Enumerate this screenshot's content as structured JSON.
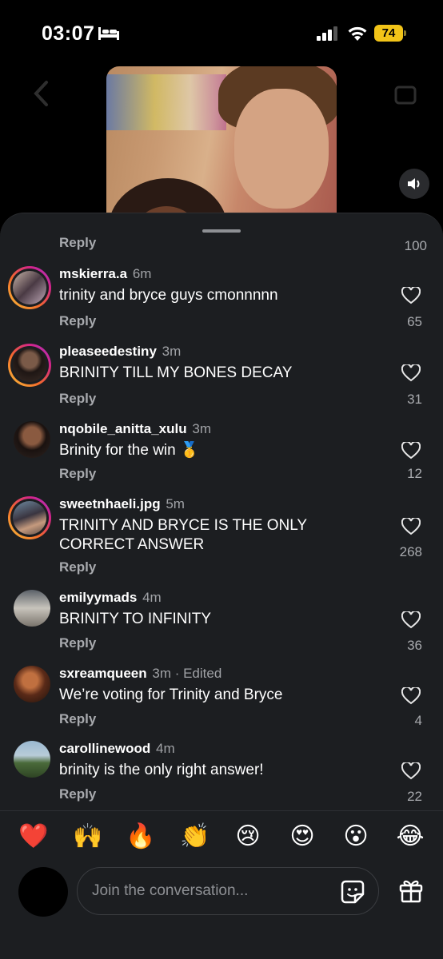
{
  "status_bar": {
    "time": "03:07",
    "battery": "74",
    "colors": {
      "battery": "#f2c418"
    }
  },
  "comments_header": {
    "partial_reply": "Reply",
    "partial_likes": "100"
  },
  "comments": [
    {
      "username": "mskierra.a",
      "time": "6m",
      "text": "trinity and bryce guys cmonnnnn",
      "reply": "Reply",
      "likes": "65"
    },
    {
      "username": "pleaseedestiny",
      "time": "3m",
      "text": "BRINITY TILL MY BONES DECAY",
      "reply": "Reply",
      "likes": "31"
    },
    {
      "username": "nqobile_anitta_xulu",
      "time": "3m",
      "text": "Brinity for the win 🥇",
      "reply": "Reply",
      "likes": "12"
    },
    {
      "username": "sweetnhaeli.jpg",
      "time": "5m",
      "text": "TRINITY AND BRYCE IS THE ONLY CORRECT ANSWER",
      "reply": "Reply",
      "likes": "268"
    },
    {
      "username": "emilyymads",
      "time": "4m",
      "text": "BRINITY TO INFINITY",
      "reply": "Reply",
      "likes": "36"
    },
    {
      "username": "sxreamqueen",
      "time": "3m · Edited",
      "text": "We’re voting for Trinity and Bryce",
      "reply": "Reply",
      "likes": "4"
    },
    {
      "username": "carollinewood",
      "time": "4m",
      "text": "brinity is the only right answer!",
      "reply": "Reply",
      "likes": "22"
    }
  ],
  "reactions": [
    "❤️",
    "🙌",
    "🔥",
    "👏",
    "😢",
    "😍",
    "😮",
    "😂"
  ],
  "composer": {
    "placeholder": "Join the conversation..."
  },
  "icons": {
    "status": [
      "bed-icon",
      "signal-icon",
      "wifi-icon"
    ],
    "actions": [
      "volume-icon",
      "heart-icon",
      "sticker-icon",
      "gift-icon"
    ]
  }
}
